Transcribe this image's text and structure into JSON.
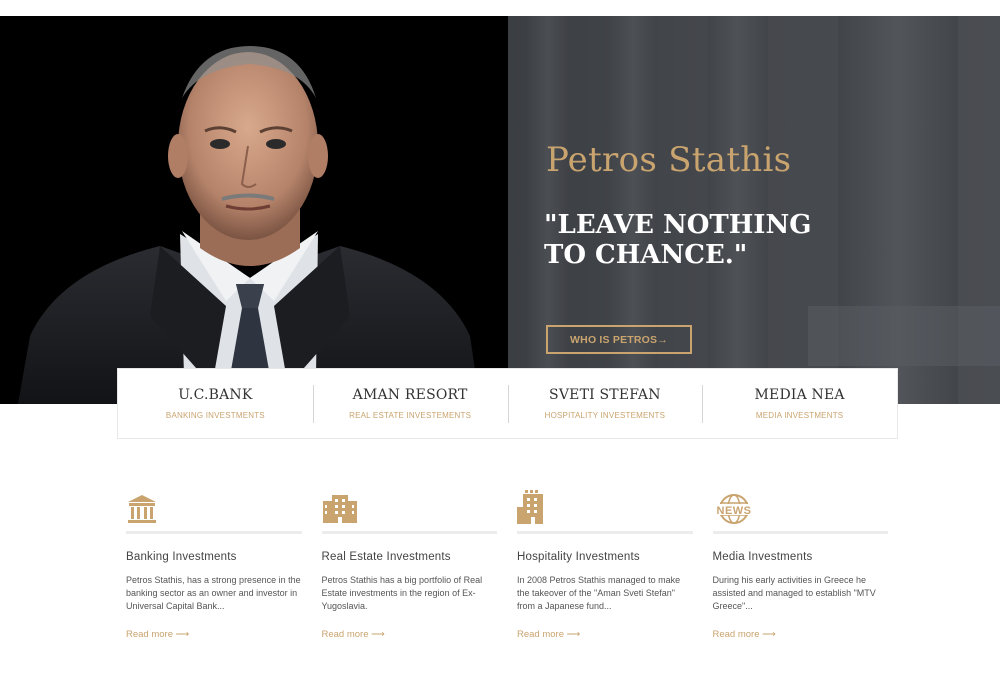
{
  "hero": {
    "name": "Petros Stathis",
    "quote": "\"LEAVE NOTHING TO CHANCE.\"",
    "cta_label": "WHO IS PETROS→"
  },
  "cards": [
    {
      "title": "U.C.BANK",
      "subtitle": "BANKING INVESTMENTS"
    },
    {
      "title": "AMAN RESORT",
      "subtitle": "REAL ESTATE INVESTEMENTS"
    },
    {
      "title": "SVETI STEFAN",
      "subtitle": "HOSPITALITY INVESTEMENTS"
    },
    {
      "title": "MEDIA NEA",
      "subtitle": "MEDIA INVESTMENTS"
    }
  ],
  "features": [
    {
      "icon": "bank-icon",
      "title": "Banking Investments",
      "text": "Petros Stathis, has a strong presence in the banking sector as an owner and investor in Universal Capital Bank...",
      "link": "Read more ⟶"
    },
    {
      "icon": "building-icon",
      "title": "Real Estate Investments",
      "text": "Petros Stathis has a big portfolio of Real Estate investments in the region of Ex-Yugoslavia.",
      "link": "Read more ⟶"
    },
    {
      "icon": "hotel-icon",
      "title": "Hospitality Investments",
      "text": "In 2008 Petros Stathis managed to make the takeover of the \"Aman Sveti Stefan\" from a Japanese fund...",
      "link": "Read more ⟶"
    },
    {
      "icon": "news-globe-icon",
      "title": "Media Investments",
      "text": "During his early activities in Greece he assisted and managed to establish \"MTV Greece\"...",
      "link": "Read more ⟶",
      "icon_text": "NEWS"
    }
  ],
  "colors": {
    "accent": "#c9a46f",
    "hero_dark": "#000000",
    "hero_gray": "#44474c"
  }
}
